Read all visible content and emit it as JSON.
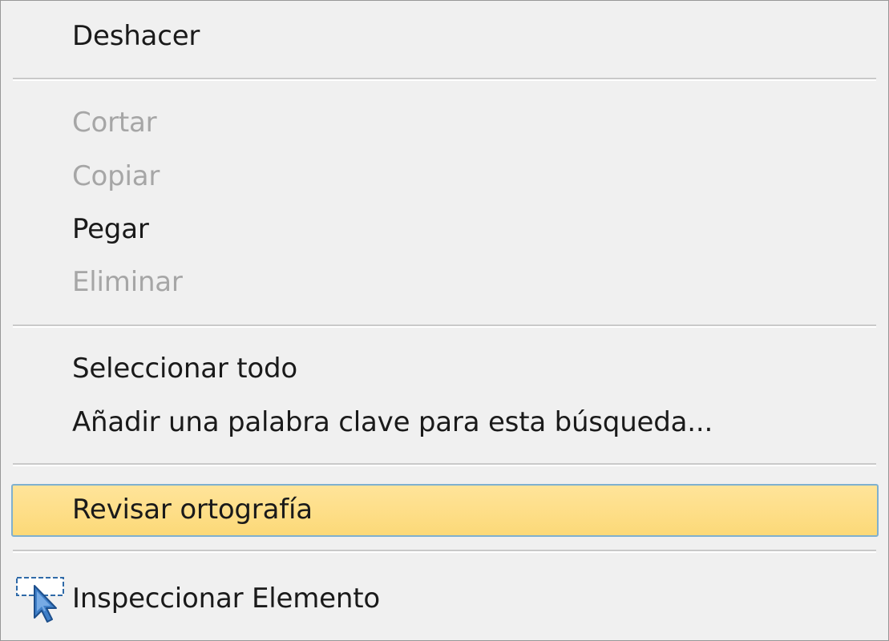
{
  "menu": {
    "items": [
      {
        "label": "Deshacer",
        "state": "enabled"
      },
      {
        "label": "Cortar",
        "state": "disabled"
      },
      {
        "label": "Copiar",
        "state": "disabled"
      },
      {
        "label": "Pegar",
        "state": "enabled"
      },
      {
        "label": "Eliminar",
        "state": "disabled"
      },
      {
        "label": "Seleccionar todo",
        "state": "enabled"
      },
      {
        "label": "Añadir una palabra clave para esta búsqueda...",
        "state": "enabled"
      },
      {
        "label": "Revisar ortografía",
        "state": "highlighted"
      },
      {
        "label": "Inspeccionar Elemento",
        "state": "enabled",
        "icon": "inspect-element-icon"
      }
    ]
  },
  "colors": {
    "menu_background": "#f0f0f0",
    "text": "#1a1a1a",
    "disabled_text": "#a6a6a6",
    "highlight_fill": "#fde08c",
    "highlight_border": "#7fb0cf",
    "separator": "#c9c9c9"
  }
}
